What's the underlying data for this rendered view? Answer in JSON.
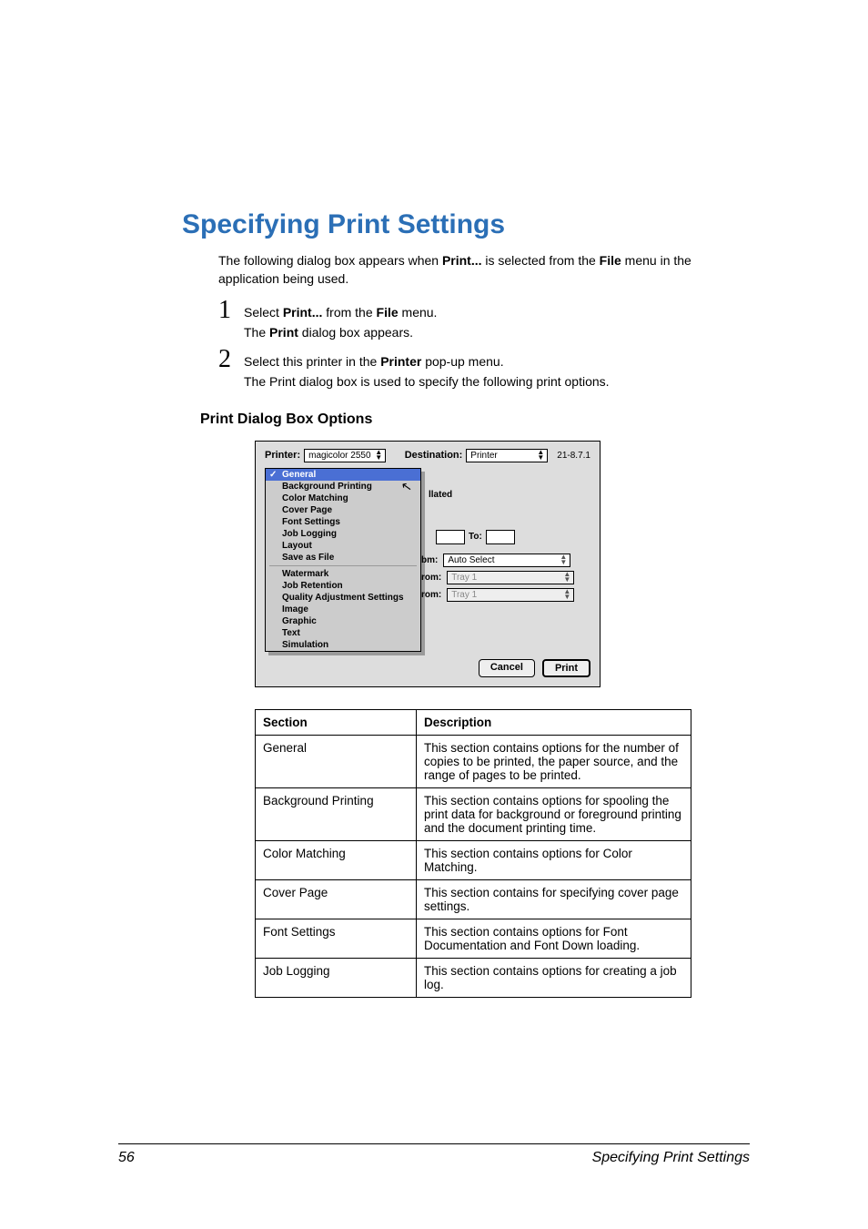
{
  "title": "Specifying Print Settings",
  "intro_pre": "The following dialog box appears when ",
  "intro_bold1": "Print...",
  "intro_mid": " is selected from the ",
  "intro_bold2": "File",
  "intro_post": " menu in the application being used.",
  "steps": [
    {
      "num": "1",
      "pre": "Select ",
      "b1": "Print...",
      "mid": " from the ",
      "b2": "File",
      "post": " menu.",
      "sub_pre": "The ",
      "sub_b": "Print",
      "sub_post": " dialog box appears."
    },
    {
      "num": "2",
      "pre": "Select this printer in the ",
      "b1": "Printer",
      "mid": "",
      "b2": "",
      "post": " pop-up menu.",
      "sub_pre": "The Print dialog box is used to specify the following print options.",
      "sub_b": "",
      "sub_post": ""
    }
  ],
  "subhead": "Print Dialog Box Options",
  "dialog": {
    "printer_label": "Printer:",
    "printer_value": "magicolor 2550",
    "dest_label": "Destination:",
    "dest_value": "Printer",
    "version": "21-8.7.1",
    "menu_items_a": [
      "General",
      "Background Printing",
      "Color Matching",
      "Cover Page",
      "Font Settings",
      "Job Logging",
      "Layout",
      "Save as File"
    ],
    "menu_items_b": [
      "Watermark",
      "Job Retention",
      "Quality Adjustment Settings",
      "Image",
      "Graphic",
      "Text",
      "Simulation"
    ],
    "lated": "llated",
    "to_label": "To:",
    "row_bm_label": "bm:",
    "row_bm_value": "Auto Select",
    "row_rom_label": "rom:",
    "row_rom_value": "Tray 1",
    "row_rom2_label": "rom:",
    "row_rom2_value": "Tray 1",
    "cancel": "Cancel",
    "print": "Print"
  },
  "table": {
    "h1": "Section",
    "h2": "Description",
    "rows": [
      {
        "s": "General",
        "d": "This section contains options for the number of copies to be printed, the paper source, and the range of pages to be printed."
      },
      {
        "s": "Background Printing",
        "d": "This section contains options for spooling the print data for background or foreground printing and the document printing time."
      },
      {
        "s": "Color Matching",
        "d": "This section contains options for Color Matching."
      },
      {
        "s": "Cover Page",
        "d": "This section contains for specifying cover page settings."
      },
      {
        "s": "Font Settings",
        "d": "This section contains options for Font Documentation and Font Down loading."
      },
      {
        "s": "Job Logging",
        "d": "This section contains options for creating a job log."
      }
    ]
  },
  "footer": {
    "page_num": "56",
    "title": "Specifying Print Settings"
  }
}
